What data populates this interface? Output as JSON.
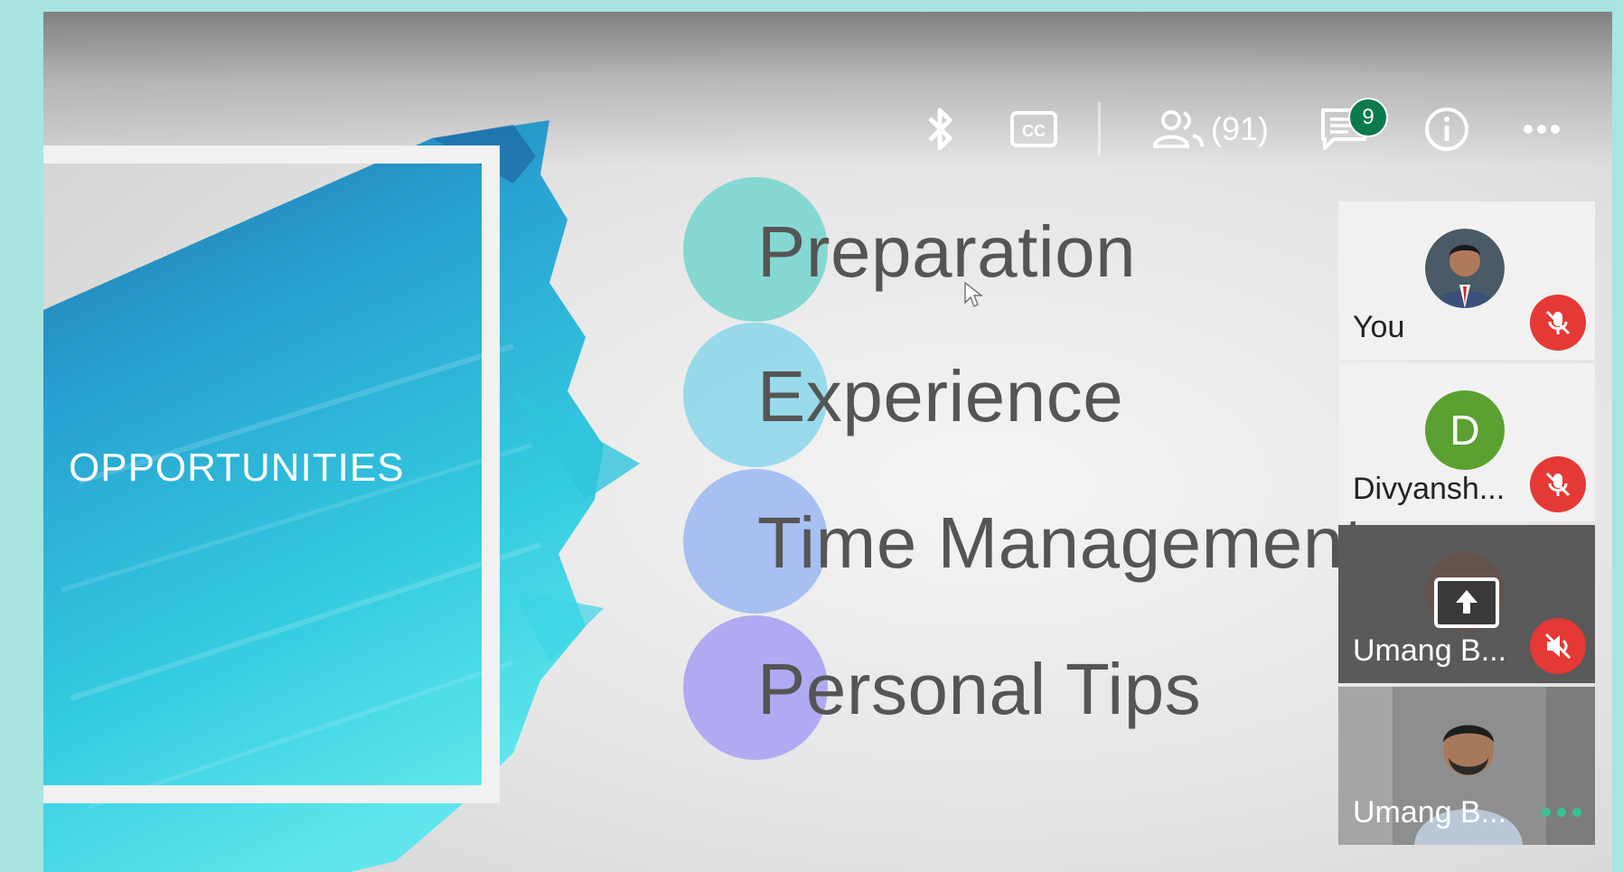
{
  "toolbar": {
    "participants_count": "(91)",
    "chat_badge": "9"
  },
  "slide": {
    "title": "OPPORTUNITIES",
    "items": [
      {
        "label": "Preparation",
        "color": "#7ad6cf"
      },
      {
        "label": "Experience",
        "color": "#8ed7ea"
      },
      {
        "label": "Time Management",
        "color": "#9fb9f1"
      },
      {
        "label": "Personal Tips",
        "color": "#a9a3f2"
      }
    ]
  },
  "participants": [
    {
      "name": "You",
      "avatar": "photo",
      "status": "mic-off-icon"
    },
    {
      "name": "Divyansh...",
      "avatar": "D",
      "avatar_color": "#5aa132",
      "status": "mic-off-icon"
    },
    {
      "name": "Umang B...",
      "avatar": "screen-share-icon",
      "status": "speaker-off-icon"
    },
    {
      "name": "Umang B...",
      "avatar": "video",
      "status": "more-dots-icon"
    }
  ],
  "colors": {
    "mute_red": "#e53935",
    "badge_green": "#0b7a4c",
    "brush_blue": "#2aa9d4"
  }
}
